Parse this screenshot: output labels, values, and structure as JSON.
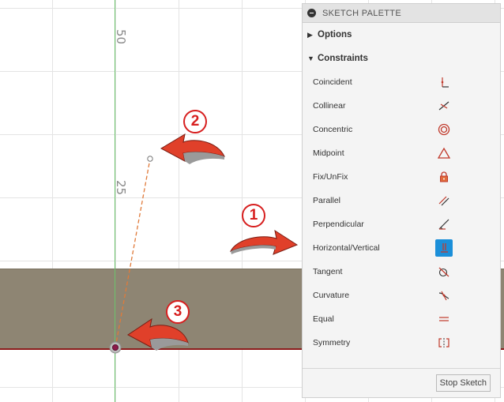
{
  "canvas": {
    "axis_labels": [
      "50",
      "25"
    ]
  },
  "callouts": [
    "1",
    "2",
    "3"
  ],
  "palette": {
    "title": "SKETCH PALETTE",
    "sections": {
      "options": "Options",
      "constraints": "Constraints"
    },
    "constraints": [
      {
        "label": "Coincident",
        "icon": "coincident-icon",
        "active": false
      },
      {
        "label": "Collinear",
        "icon": "collinear-icon",
        "active": false
      },
      {
        "label": "Concentric",
        "icon": "concentric-icon",
        "active": false
      },
      {
        "label": "Midpoint",
        "icon": "midpoint-icon",
        "active": false
      },
      {
        "label": "Fix/UnFix",
        "icon": "lock-icon",
        "active": false
      },
      {
        "label": "Parallel",
        "icon": "parallel-icon",
        "active": false
      },
      {
        "label": "Perpendicular",
        "icon": "perpendicular-icon",
        "active": false
      },
      {
        "label": "Horizontal/Vertical",
        "icon": "horizontal-vertical-icon",
        "active": true
      },
      {
        "label": "Tangent",
        "icon": "tangent-icon",
        "active": false
      },
      {
        "label": "Curvature",
        "icon": "curvature-icon",
        "active": false
      },
      {
        "label": "Equal",
        "icon": "equal-icon",
        "active": false
      },
      {
        "label": "Symmetry",
        "icon": "symmetry-icon",
        "active": false
      }
    ],
    "stop_sketch_label": "Stop Sketch"
  },
  "colors": {
    "accent_active": "#1b8fd9",
    "callout_red": "#d71f1f",
    "sketch_line": "#e07a3a",
    "body_fill": "#8e8573",
    "axis_green": "#6cc46c"
  }
}
